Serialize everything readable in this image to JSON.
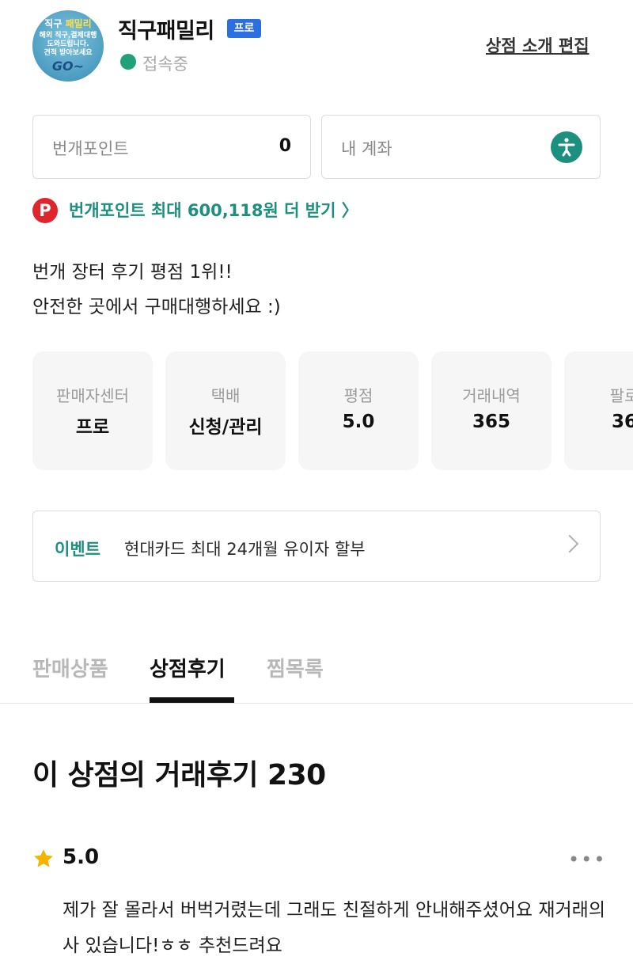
{
  "shop": {
    "name": "직구패밀리",
    "badge": "프로",
    "status": "접속중",
    "edit_link": "상점 소개 편집",
    "avatar": {
      "line1_a": "직구",
      "line1_b": "패밀리",
      "line2": "해외 직구,결제대행",
      "line3": "도와드립니다.",
      "line4": "견적 받아보세요",
      "line5": "GO~"
    }
  },
  "points_box": {
    "label": "번개포인트",
    "value": "0"
  },
  "account_box": {
    "label": "내 계좌",
    "icon": "payment-icon"
  },
  "promo": {
    "icon_letter": "P",
    "text": "번개포인트 최대 600,118원 더 받기 〉"
  },
  "intro": {
    "line1": "번개 장터 후기 평점 1위!!",
    "line2": "안전한 곳에서 구매대행하세요 :)"
  },
  "stats": [
    {
      "label": "판매자센터",
      "value": "프로"
    },
    {
      "label": "택배",
      "value": "신청/관리"
    },
    {
      "label": "평점",
      "value": "5.0"
    },
    {
      "label": "거래내역",
      "value": "365"
    },
    {
      "label": "팔로",
      "value": "36"
    }
  ],
  "event": {
    "tag": "이벤트",
    "text": "현대카드 최대 24개월 유이자 할부"
  },
  "tabs": [
    {
      "label": "판매상품",
      "active": false
    },
    {
      "label": "상점후기",
      "active": true
    },
    {
      "label": "찜목록",
      "active": false
    }
  ],
  "reviews": {
    "title": "이 상점의 거래후기 230",
    "items": [
      {
        "rating": "5.0",
        "more": "•••",
        "text": "제가 잘 몰라서 버벅거렸는데 그래도 친절하게 안내해주셨어요 재거래의사 있습니다!ㅎㅎ 추천드려요"
      }
    ]
  },
  "colors": {
    "accent_green": "#1c8f7e",
    "status_green": "#21a17a",
    "badge_blue": "#2c6fe0",
    "point_red": "#e0262c",
    "star_yellow": "#f5b400"
  }
}
